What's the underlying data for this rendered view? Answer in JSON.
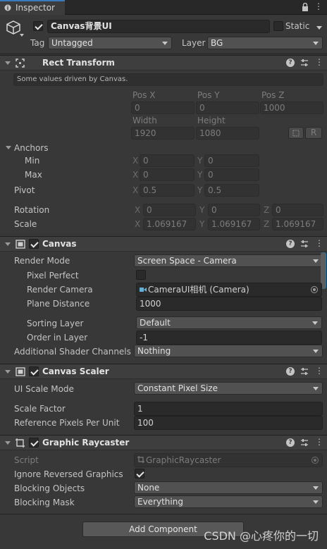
{
  "tab": {
    "label": "Inspector"
  },
  "object": {
    "name": "Canvas背景UI",
    "static_label": "Static",
    "tag_label": "Tag",
    "tag_value": "Untagged",
    "layer_label": "Layer",
    "layer_value": "BG"
  },
  "rect_transform": {
    "title": "Rect Transform",
    "notice": "Some values driven by Canvas.",
    "pos_x_label": "Pos X",
    "pos_y_label": "Pos Y",
    "pos_z_label": "Pos Z",
    "pos_x": "0",
    "pos_y": "0",
    "pos_z": "1000",
    "width_label": "Width",
    "height_label": "Height",
    "width": "1920",
    "height": "1080",
    "r_button": "R",
    "anchors_label": "Anchors",
    "min_label": "Min",
    "max_label": "Max",
    "min_x": "0",
    "min_y": "0",
    "max_x": "0",
    "max_y": "0",
    "pivot_label": "Pivot",
    "pivot_x": "0.5",
    "pivot_y": "0.5",
    "rotation_label": "Rotation",
    "rot_x": "0",
    "rot_y": "0",
    "rot_z": "0",
    "scale_label": "Scale",
    "scale_x": "1.069167",
    "scale_y": "1.069167",
    "scale_z": "1.069167",
    "x": "X",
    "y": "Y",
    "z": "Z"
  },
  "canvas": {
    "title": "Canvas",
    "render_mode_label": "Render Mode",
    "render_mode": "Screen Space - Camera",
    "pixel_perfect_label": "Pixel Perfect",
    "render_camera_label": "Render Camera",
    "render_camera": "CameraUI相机 (Camera)",
    "plane_distance_label": "Plane Distance",
    "plane_distance": "1000",
    "sorting_layer_label": "Sorting Layer",
    "sorting_layer": "Default",
    "order_in_layer_label": "Order in Layer",
    "order_in_layer": "-1",
    "shader_channels_label": "Additional Shader Channels",
    "shader_channels": "Nothing"
  },
  "canvas_scaler": {
    "title": "Canvas Scaler",
    "ui_scale_mode_label": "UI Scale Mode",
    "ui_scale_mode": "Constant Pixel Size",
    "scale_factor_label": "Scale Factor",
    "scale_factor": "1",
    "ref_ppu_label": "Reference Pixels Per Unit",
    "ref_ppu": "100"
  },
  "graphic_raycaster": {
    "title": "Graphic Raycaster",
    "script_label": "Script",
    "script": "GraphicRaycaster",
    "ignore_reversed_label": "Ignore Reversed Graphics",
    "blocking_objects_label": "Blocking Objects",
    "blocking_objects": "None",
    "blocking_mask_label": "Blocking Mask",
    "blocking_mask": "Everything"
  },
  "add_component": "Add Component",
  "watermark": "CSDN @心疼你的一切",
  "colors": {
    "accent": "#3a79bb",
    "panel": "#383838",
    "header": "#3e3e3e",
    "field": "#2a2a2a"
  }
}
